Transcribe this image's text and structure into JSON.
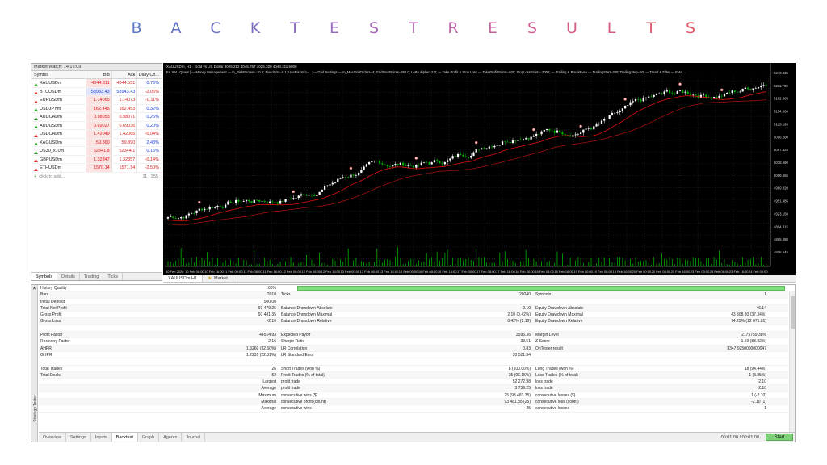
{
  "banner": {
    "letters": [
      "B",
      "A",
      "C",
      "K",
      "T",
      "E",
      "S",
      "T",
      "R",
      "E",
      "S",
      "U",
      "L",
      "T",
      "S"
    ],
    "colors": [
      "#5a76c8",
      "#6374c6",
      "#6f72c3",
      "#7b70c0",
      "#8a6ebd",
      "#986cba",
      "#a66ab7",
      "#b468b3",
      "#bd66a9",
      "#c4649f",
      "#cb6294",
      "#d1608a",
      "#d75e7f",
      "#dd5c74",
      "#e35a69"
    ]
  },
  "market_watch": {
    "title": "Market Watch: 14:15:09",
    "headers": [
      "Symbol",
      "Bid",
      "Ask",
      "Daily Ch..."
    ],
    "rows": [
      {
        "symbol": "XAUUSDm",
        "bid": "4044.311",
        "ask": "4044.551",
        "change": "0.73%",
        "bid_color": "red",
        "change_color": "blue"
      },
      {
        "symbol": "BTCUSDm",
        "bid": "58933.43",
        "ask": "58943.43",
        "change": "-2.05%",
        "bid_color": "blue",
        "change_color": "red"
      },
      {
        "symbol": "EURUSDm",
        "bid": "1.14065",
        "ask": "1.14073",
        "change": "-0.11%",
        "bid_color": "red",
        "change_color": "red"
      },
      {
        "symbol": "USDJPYm",
        "bid": "162.445",
        "ask": "162.453",
        "change": "0.32%",
        "bid_color": "red",
        "change_color": "blue"
      },
      {
        "symbol": "AUDCADm",
        "bid": "0.98053",
        "ask": "0.98071",
        "change": "0.26%",
        "bid_color": "red",
        "change_color": "blue"
      },
      {
        "symbol": "AUDUSDm",
        "bid": "0.69027",
        "ask": "0.69036",
        "change": "0.20%",
        "bid_color": "red",
        "change_color": "blue"
      },
      {
        "symbol": "USDCADm",
        "bid": "1.42049",
        "ask": "1.42065",
        "change": "-0.04%",
        "bid_color": "red",
        "change_color": "red"
      },
      {
        "symbol": "XAGUSDm",
        "bid": "59.860",
        "ask": "59.890",
        "change": "2.48%",
        "bid_color": "red",
        "change_color": "blue"
      },
      {
        "symbol": "US30_x10m",
        "bid": "52341.8",
        "ask": "52344.1",
        "change": "0.16%",
        "bid_color": "red",
        "change_color": "blue"
      },
      {
        "symbol": "GBPUSDm",
        "bid": "1.32347",
        "ask": "1.32357",
        "change": "-0.14%",
        "bid_color": "red",
        "change_color": "red"
      },
      {
        "symbol": "ETHUSDm",
        "bid": "1570.14",
        "ask": "1571.14",
        "change": "-2.50%",
        "bid_color": "red",
        "change_color": "red"
      }
    ],
    "add_label": "click to add...",
    "count": "11 / 355",
    "tabs": [
      "Symbols",
      "Details",
      "Trading",
      "Ticks"
    ]
  },
  "chart": {
    "info_line1": "XAUUSDm, H1 · Gold vs US Dollar  4025.212  4046.767  4025.320  4044.311  5900",
    "info_line2": "EA XAU Quant | --- Money Management --- m_RiskPercent=10.0; FixedLots=0.1; UseRiskInfo=...; --- Grid Settings --- m_MaxGridOrders=4; GridStepPoints=850.0; LotMultiplier=2.0; --- Take Profit & Stop Loss --- TakeProfitPoints=600; StopLossPoints=2000; --- Trailing & BreakEven --- TrailingStart=300; TrailingStep=50; --- Trend & Filter --- EMA...",
    "price_labels": [
      "5240.835",
      "5211.700",
      "5182.865",
      "5154.000",
      "5125.195",
      "5096.260",
      "5067.425",
      "5038.590",
      "5009.655",
      "4980.820",
      "4951.985",
      "4923.150",
      "4894.315",
      "4865.480",
      "4836.645"
    ],
    "time_labels": [
      "10 Feb 2026",
      "10 Feb 08:00",
      "10 Feb 16:00",
      "11 Feb 00:00",
      "11 Feb 08:00",
      "11 Feb 16:00",
      "12 Feb 00:00",
      "12 Feb 08:00",
      "12 Feb 16:00",
      "13 Feb 00:00",
      "13 Feb 08:00",
      "13 Feb 16:00",
      "16 Feb 00:00",
      "16 Feb 08:00",
      "16 Feb 16:00",
      "17 Feb 00:00",
      "17 Feb 08:00",
      "17 Feb 16:00",
      "18 Feb 00:00",
      "18 Feb 08:00",
      "18 Feb 16:00",
      "19 Feb 00:00",
      "19 Feb 08:00",
      "19 Feb 16:00",
      "20 Feb 00:00",
      "20 Feb 08:00",
      "20 Feb 16:00",
      "23 Feb 00:00",
      "23 Feb 08:00",
      "23 Feb 16:00",
      "24 Feb 00:00"
    ],
    "tabs": [
      "XAUUSDm,H1",
      "Market"
    ],
    "colors": {
      "bg": "#000000",
      "grid": "#2a2a2a",
      "bull": "#ffffff",
      "bear": "#00b000",
      "ma_fast": "#e01010",
      "ma_slow": "#a01010",
      "volume": "#00b000"
    }
  },
  "tester": {
    "side_label": "Strategy Tester",
    "quality": {
      "label": "History Quality",
      "value": "100%"
    },
    "rows": [
      [
        "Bars",
        "2010",
        "Ticks",
        "120240",
        "Symbols",
        "1"
      ],
      [
        "Initial Deposit",
        "500.00",
        "",
        "",
        "",
        ""
      ],
      [
        "Total Net Profit",
        "93 479.25",
        "Balance Drawdown Absolute",
        "2.10",
        "Equity Drawdown Absolute",
        "46.14"
      ],
      [
        "Gross Profit",
        "93 481.35",
        "Balance Drawdown Maximal",
        "2.10 (0.42%)",
        "Equity Drawdown Maximal",
        "43 308.30 (37.34%)"
      ],
      [
        "Gross Loss",
        "-2.10",
        "Balance Drawdown Relative",
        "0.42% (2.10)",
        "Equity Drawdown Relative",
        "74.25% (12 671.81)"
      ],
      [
        "",
        "",
        "",
        "",
        "",
        ""
      ],
      [
        "Profit Factor",
        "44514.93",
        "Expected Payoff",
        "3595.36",
        "Margin Level",
        "2175759.38%"
      ],
      [
        "Recovery Factor",
        "2.16",
        "Sharpe Ratio",
        "33.51",
        "Z-Score",
        "-1.59 (88.82%)"
      ],
      [
        "AHPR",
        "1.3260 (32.60%)",
        "LR Correlation",
        "0.83",
        "OnTester result",
        "9347.9250000000047"
      ],
      [
        "GHPR",
        "1.2231 (22.31%)",
        "LR Standard Error",
        "20 521.34",
        "",
        ""
      ],
      [
        "",
        "",
        "",
        "",
        "",
        ""
      ],
      [
        "Total Trades",
        "26",
        "Short Trades (won %)",
        "8 (100.00%)",
        "Long Trades (won %)",
        "18 (94.44%)"
      ],
      [
        "Total Deals",
        "52",
        "Profit Trades (% of total)",
        "25 (96.15%)",
        "Loss Trades (% of total)",
        "1 (3.85%)"
      ],
      [
        "",
        "Largest",
        "profit trade",
        "52 272.98",
        "loss trade",
        "-2.10"
      ],
      [
        "",
        "Average",
        "profit trade",
        "3 739.25",
        "loss trade",
        "-2.10"
      ],
      [
        "",
        "Maximum",
        "consecutive wins ($)",
        "25 (93 481.35)",
        "consecutive losses ($)",
        "1 (-2.10)"
      ],
      [
        "",
        "Maximal",
        "consecutive profit (count)",
        "93 481.35 (25)",
        "consecutive loss (count)",
        "-2.10 (1)"
      ],
      [
        "",
        "Average",
        "consecutive wins",
        "25",
        "consecutive losses",
        "1"
      ]
    ],
    "tabs": [
      "Overview",
      "Settings",
      "Inputs",
      "Backtest",
      "Graph",
      "Agents",
      "Journal"
    ],
    "active_tab": "Backtest",
    "timer": "00:01:08 / 00:01:08",
    "start_label": "Start"
  }
}
